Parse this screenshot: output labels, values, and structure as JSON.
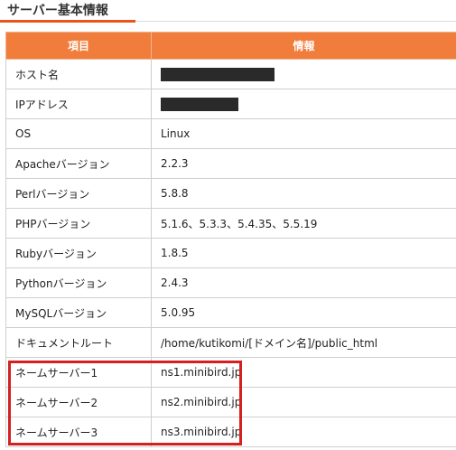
{
  "section": {
    "title": "サーバー基本情報"
  },
  "table": {
    "headers": [
      "項目",
      "情報"
    ],
    "rows": [
      {
        "label": "ホスト名",
        "value": ""
      },
      {
        "label": "IPアドレス",
        "value": ""
      },
      {
        "label": "OS",
        "value": "Linux"
      },
      {
        "label": "Apacheバージョン",
        "value": "2.2.3"
      },
      {
        "label": "Perlバージョン",
        "value": "5.8.8"
      },
      {
        "label": "PHPバージョン",
        "value": "5.1.6、5.3.3、5.4.35、5.5.19"
      },
      {
        "label": "Rubyバージョン",
        "value": "1.8.5"
      },
      {
        "label": "Pythonバージョン",
        "value": "2.4.3"
      },
      {
        "label": "MySQLバージョン",
        "value": "5.0.95"
      },
      {
        "label": "ドキュメントルート",
        "value": "/home/kutikomi/[ドメイン名]/public_html"
      },
      {
        "label": "ネームサーバー1",
        "value": "ns1.minibird.jp"
      },
      {
        "label": "ネームサーバー2",
        "value": "ns2.minibird.jp"
      },
      {
        "label": "ネームサーバー3",
        "value": "ns3.minibird.jp"
      }
    ]
  },
  "colors": {
    "header_bg": "#f07d3c",
    "accent_rule": "#e8541a",
    "highlight": "#d61f1f",
    "redaction": "#2a2a2a"
  }
}
